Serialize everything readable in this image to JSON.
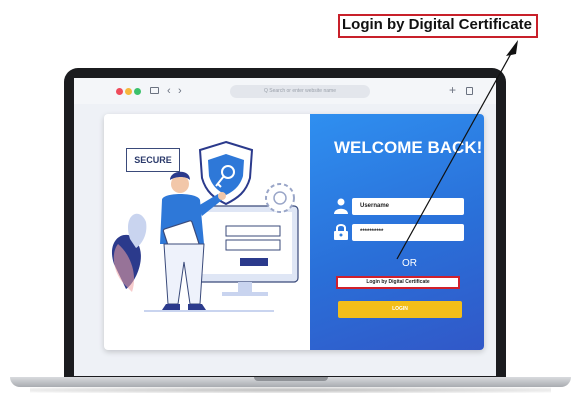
{
  "annotation": {
    "callout_label": "Login by Digital Certificate",
    "highlight_color": "#c8202a"
  },
  "browser": {
    "window_dots": [
      "#ef4b5b",
      "#f6b73c",
      "#3cc16c"
    ],
    "icons": [
      "sidebar-icon",
      "back-icon",
      "forward-icon",
      "new-tab-icon",
      "copy-icon"
    ],
    "nav_back": "‹",
    "nav_forward": "›",
    "new_tab": "+",
    "url_placeholder": "Q  Search or enter website name"
  },
  "illustration": {
    "secure_label": "SECURE"
  },
  "login": {
    "heading": "WELCOME BACK!",
    "username_label": "Username",
    "password_value": "**********",
    "or_text": "OR",
    "certificate_button": "Login by Digital Certificate",
    "login_button": "LOGIN",
    "accent_color": "#2f8ff0",
    "button_color": "#f3be19"
  }
}
